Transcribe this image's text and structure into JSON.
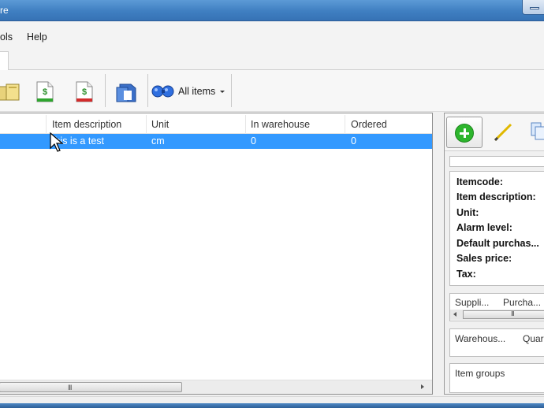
{
  "window": {
    "title": "re"
  },
  "menu": {
    "items": [
      "ols",
      "Help"
    ]
  },
  "toolbar": {
    "dropdown_label": "All items"
  },
  "list": {
    "columns": [
      "Item description",
      "Unit",
      "In warehouse",
      "Ordered"
    ],
    "rows": [
      {
        "description": "this is a test",
        "unit": "cm",
        "in_warehouse": "0",
        "ordered": "0",
        "selected": true
      }
    ],
    "scroll_grip": "III",
    "scroll_arrow_right": "▸"
  },
  "details": {
    "fields": [
      "Itemcode:",
      "Item description:",
      "Unit:",
      "Alarm level:",
      "Default purchas...",
      "Sales price:",
      "Tax:"
    ],
    "suppliers_columns": [
      "Suppli...",
      "Purcha..."
    ],
    "suppliers_scroll_grip": "III",
    "warehouse_columns": [
      "Warehous...",
      "Quar"
    ],
    "groups_header": "Item groups"
  },
  "colors": {
    "selection": "#3399ff",
    "titlebar": "#3f7fc1",
    "add_green": "#2db52d",
    "pencil_yellow": "#f0c000"
  }
}
